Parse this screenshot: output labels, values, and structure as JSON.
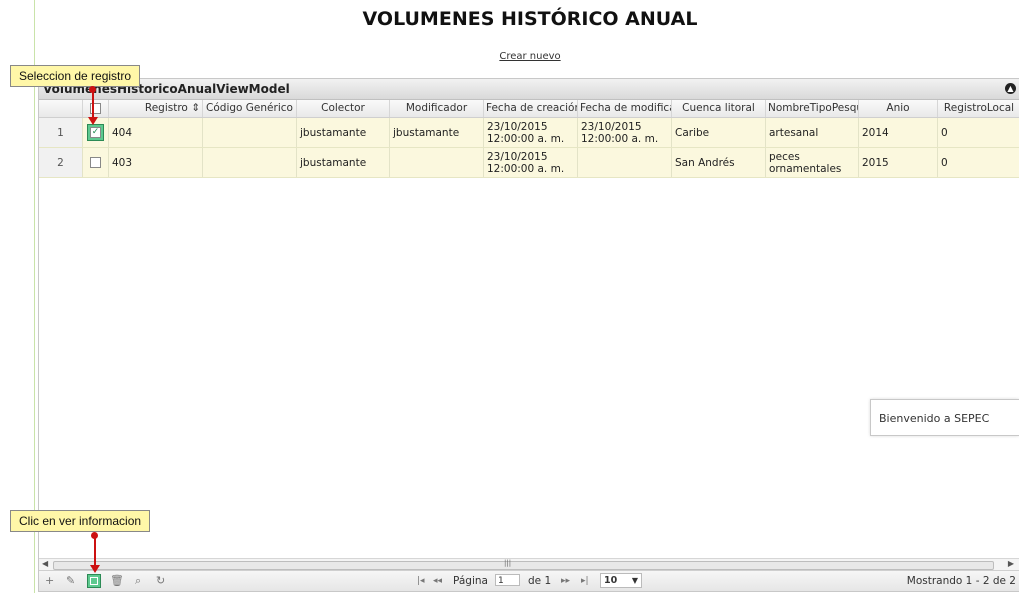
{
  "page": {
    "title": "VOLUMENES HISTÓRICO ANUAL",
    "create_link": "Crear nuevo"
  },
  "grid": {
    "caption": "VolumenesHistoricoAnualViewModel",
    "caption_toggle_icon": "collapse-icon",
    "columns": [
      "Registro ⇕",
      "Código Genérico",
      "Colector",
      "Modificador",
      "Fecha de creación",
      "Fecha de modificación",
      "Cuenca litoral",
      "NombreTipoPesquería",
      "Anio",
      "RegistroLocal"
    ],
    "rows": [
      {
        "num": "1",
        "selected": true,
        "registro": "404",
        "codigo": "",
        "colector": "jbustamante",
        "modificador": "jbustamante",
        "fecha_creacion": "23/10/2015 12:00:00 a. m.",
        "fecha_modificacion": "23/10/2015 12:00:00 a. m.",
        "cuenca": "Caribe",
        "tipo": "artesanal",
        "anio": "2014",
        "registro_local": "0"
      },
      {
        "num": "2",
        "selected": false,
        "registro": "403",
        "codigo": "",
        "colector": "jbustamante",
        "modificador": "",
        "fecha_creacion": "23/10/2015 12:00:00 a. m.",
        "fecha_modificacion": "",
        "cuenca": "San Andrés",
        "tipo": "peces ornamentales",
        "anio": "2015",
        "registro_local": "0"
      }
    ]
  },
  "pager": {
    "page_label": "Página",
    "page_value": "1",
    "of_label": "de 1",
    "rows_per_page": "10",
    "status": "Mostrando 1 - 2 de 2"
  },
  "callouts": {
    "select_record": "Seleccion de registro",
    "view_info": "Clic en ver informacion"
  },
  "toast": {
    "text": "Bienvenido a SEPEC"
  }
}
